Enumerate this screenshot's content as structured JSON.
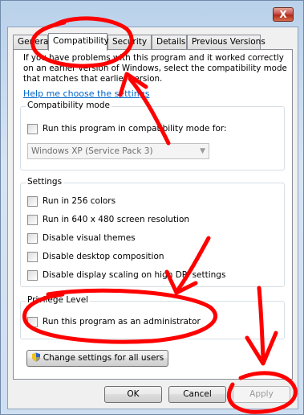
{
  "window": {
    "close_label": "X"
  },
  "tabs": [
    {
      "label": "General"
    },
    {
      "label": "Compatibility"
    },
    {
      "label": "Security"
    },
    {
      "label": "Details"
    },
    {
      "label": "Previous Versions"
    }
  ],
  "intro_text": "If you have problems with this program and it worked correctly on an earlier version of Windows, select the compatibility mode that matches that earlier version.",
  "help_link": "Help me choose the settings",
  "compat_mode": {
    "title": "Compatibility mode",
    "checkbox_label": "Run this program in compatibility mode for:",
    "checked": false,
    "selected": "Windows XP (Service Pack 3)"
  },
  "settings": {
    "title": "Settings",
    "items": [
      {
        "label": "Run in 256 colors",
        "checked": false
      },
      {
        "label": "Run in 640 x 480 screen resolution",
        "checked": false
      },
      {
        "label": "Disable visual themes",
        "checked": false
      },
      {
        "label": "Disable desktop composition",
        "checked": false
      },
      {
        "label": "Disable display scaling on high DPI settings",
        "checked": false
      }
    ]
  },
  "privilege": {
    "title": "Privilege Level",
    "checkbox_label": "Run this program as an administrator",
    "checked": false
  },
  "change_all_users": "Change settings for all users",
  "buttons": {
    "ok": "OK",
    "cancel": "Cancel",
    "apply": "Apply"
  },
  "annotation_color": "#ff0000"
}
